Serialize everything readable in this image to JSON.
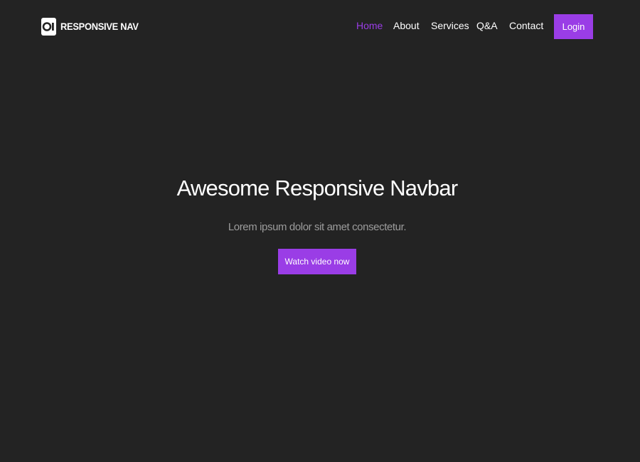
{
  "logo": {
    "text": "RESPONSIVE NAV",
    "icon": "logo-icon"
  },
  "nav": {
    "items": [
      {
        "label": "Home",
        "active": true
      },
      {
        "label": "About",
        "active": false
      },
      {
        "label": "Services",
        "active": false
      },
      {
        "label": "Q&A",
        "active": false
      },
      {
        "label": "Contact",
        "active": false
      }
    ],
    "login_label": "Login"
  },
  "hero": {
    "title": "Awesome Responsive Navbar",
    "subtitle": "Lorem ipsum dolor sit amet consectetur.",
    "cta_label": "Watch video now"
  },
  "colors": {
    "background": "#232323",
    "accent": "#9a3de6",
    "text": "#ffffff",
    "muted_text": "#9c9c9c"
  }
}
